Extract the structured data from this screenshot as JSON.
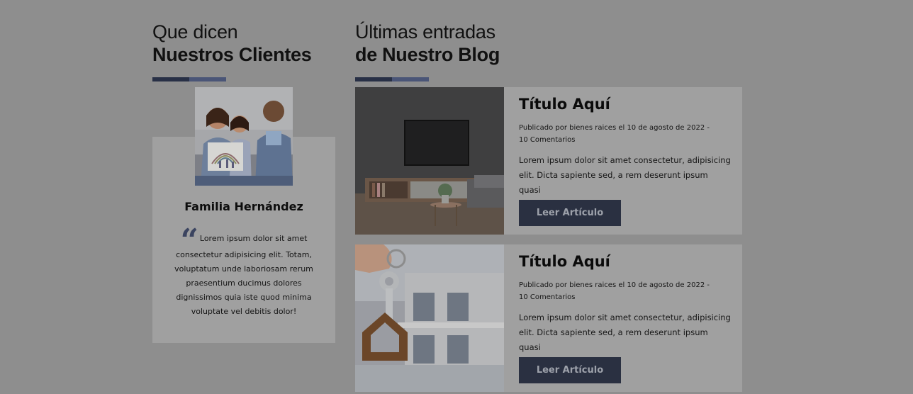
{
  "testimonials": {
    "heading_light": "Que dicen",
    "heading_bold": "Nuestros Clientes",
    "client_name": "Familia Hernández",
    "quote": "Lorem ipsum dolor sit amet consectetur adipisicing elit. Totam, voluptatum unde laboriosam rerum praesentium ducimus dolores dignissimos quia iste quod minima voluptate vel debitis dolor!",
    "quote_mark": "“"
  },
  "blog": {
    "heading_light": "Últimas entradas",
    "heading_bold": "de Nuestro Blog",
    "posts": [
      {
        "title": "Título Aquí",
        "meta": "Publicado por bienes raices el 10 de agosto de 2022 - 10 Comentarios",
        "excerpt": "Lorem ipsum dolor sit amet consectetur, adipisicing elit. Dicta sapiente sed, a rem deserunt ipsum quasi",
        "button": "Leer Artículo"
      },
      {
        "title": "Título Aquí",
        "meta": "Publicado por bienes raices el 10 de agosto de 2022 - 10 Comentarios",
        "excerpt": "Lorem ipsum dolor sit amet consectetur, adipisicing elit. Dicta sapiente sed, a rem deserunt ipsum quasi",
        "button": "Leer Artículo"
      }
    ]
  },
  "colors": {
    "overlay_background": "#8e8e8e",
    "card_background": "#a0a0a0",
    "accent_dark": "#283046",
    "accent_light": "#4a5577",
    "button_background": "#2a3041"
  }
}
